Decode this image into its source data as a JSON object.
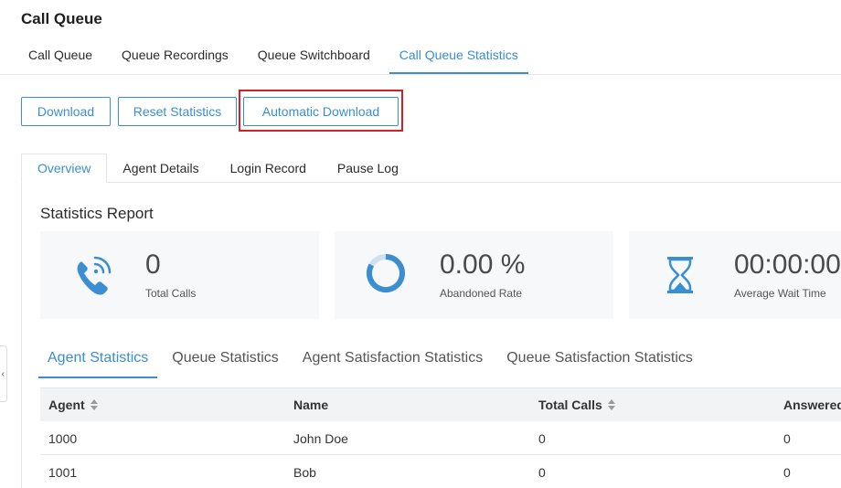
{
  "page": {
    "title": "Call Queue"
  },
  "top_tabs": [
    {
      "label": "Call Queue",
      "active": false
    },
    {
      "label": "Queue Recordings",
      "active": false
    },
    {
      "label": "Queue Switchboard",
      "active": false
    },
    {
      "label": "Call Queue Statistics",
      "active": true
    }
  ],
  "toolbar": {
    "download": "Download",
    "reset": "Reset Statistics",
    "auto_download": "Automatic Download"
  },
  "side_handle": {
    "glyph": "‹"
  },
  "inner_tabs": [
    {
      "label": "Overview",
      "active": true
    },
    {
      "label": "Agent Details",
      "active": false
    },
    {
      "label": "Login Record",
      "active": false
    },
    {
      "label": "Pause Log",
      "active": false
    }
  ],
  "report": {
    "title": "Statistics Report",
    "cards": [
      {
        "icon": "phone-ringing-icon",
        "value": "0",
        "label": "Total Calls"
      },
      {
        "icon": "ring-progress-icon",
        "value": "0.00 %",
        "label": "Abandoned Rate"
      },
      {
        "icon": "hourglass-icon",
        "value": "00:00:00",
        "label": "Average Wait Time"
      }
    ]
  },
  "stat_tabs": [
    {
      "label": "Agent Statistics",
      "active": true
    },
    {
      "label": "Queue Statistics",
      "active": false
    },
    {
      "label": "Agent Satisfaction Statistics",
      "active": false
    },
    {
      "label": "Queue Satisfaction Statistics",
      "active": false
    }
  ],
  "table": {
    "columns": [
      "Agent",
      "Name",
      "Total Calls",
      "Answered"
    ],
    "rows": [
      [
        "1000",
        "John Doe",
        "0",
        "0"
      ],
      [
        "1001",
        "Bob",
        "0",
        "0"
      ]
    ]
  },
  "colors": {
    "accent": "#3b8ed0",
    "highlight": "#d32026",
    "card_bg": "#f7f8fa"
  }
}
